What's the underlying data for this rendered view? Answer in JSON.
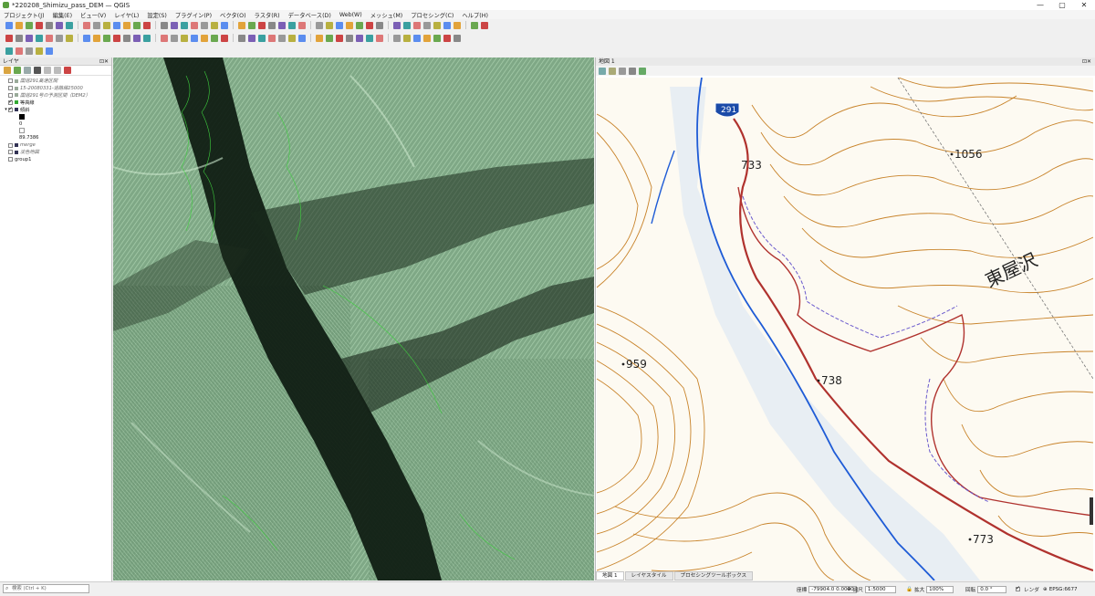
{
  "window": {
    "title": "*220208_Shimizu_pass_DEM — QGIS"
  },
  "menu": [
    "プロジェクト(J)",
    "編集(E)",
    "ビュー(V)",
    "レイヤ(L)",
    "設定(S)",
    "プラグイン(P)",
    "ベクタ(O)",
    "ラスタ(R)",
    "データベース(D)",
    "Web(W)",
    "メッシュ(M)",
    "プロセシング(C)",
    "ヘルプ(H)"
  ],
  "layers_panel": {
    "title": "レイヤ",
    "items": [
      {
        "label": "国道291高速区間",
        "checked": false,
        "italic": true
      },
      {
        "label": "15-20080331-道路縁25000",
        "checked": false,
        "italic": true
      },
      {
        "label": "国道291号の予測区間（DEM2）",
        "checked": false,
        "italic": true
      },
      {
        "label": "等高線",
        "checked": true,
        "italic": false
      },
      {
        "label": "傾斜",
        "checked": true,
        "italic": false
      },
      {
        "label": "0",
        "checked": null,
        "italic": false
      },
      {
        "label": "89.7386",
        "checked": null,
        "italic": false
      },
      {
        "label": "merge",
        "checked": false,
        "italic": true
      },
      {
        "label": "淡色地図",
        "checked": false,
        "italic": true
      },
      {
        "label": "group1",
        "checked": false,
        "italic": false
      }
    ]
  },
  "map_view2": {
    "title": "地図 1",
    "labels": {
      "route": "291",
      "e733": "733",
      "e1056": "1056",
      "e959": "959",
      "e738": "738",
      "e773": "773",
      "place": "東屋沢"
    }
  },
  "tabs": [
    "地図 1",
    "レイヤスタイル",
    "プロセシングツールボックス"
  ],
  "status": {
    "search_placeholder": "検索 (Ctrl + K)",
    "coord_label": "座標",
    "coord_value": "-79904.0 0.0000",
    "scale_label": "縮尺",
    "scale_value": "1:5000",
    "magnifier_label": "拡大",
    "magnifier_value": "100%",
    "rotation_label": "回転",
    "rotation_value": "0.0 °",
    "render_label": "レンダ",
    "crs": "EPSG:6677"
  },
  "colors": {
    "contour_brown": "#c8832a",
    "road_red": "#b0322e",
    "river_blue": "#1e5bd6",
    "relief_green": "#8fb894"
  }
}
